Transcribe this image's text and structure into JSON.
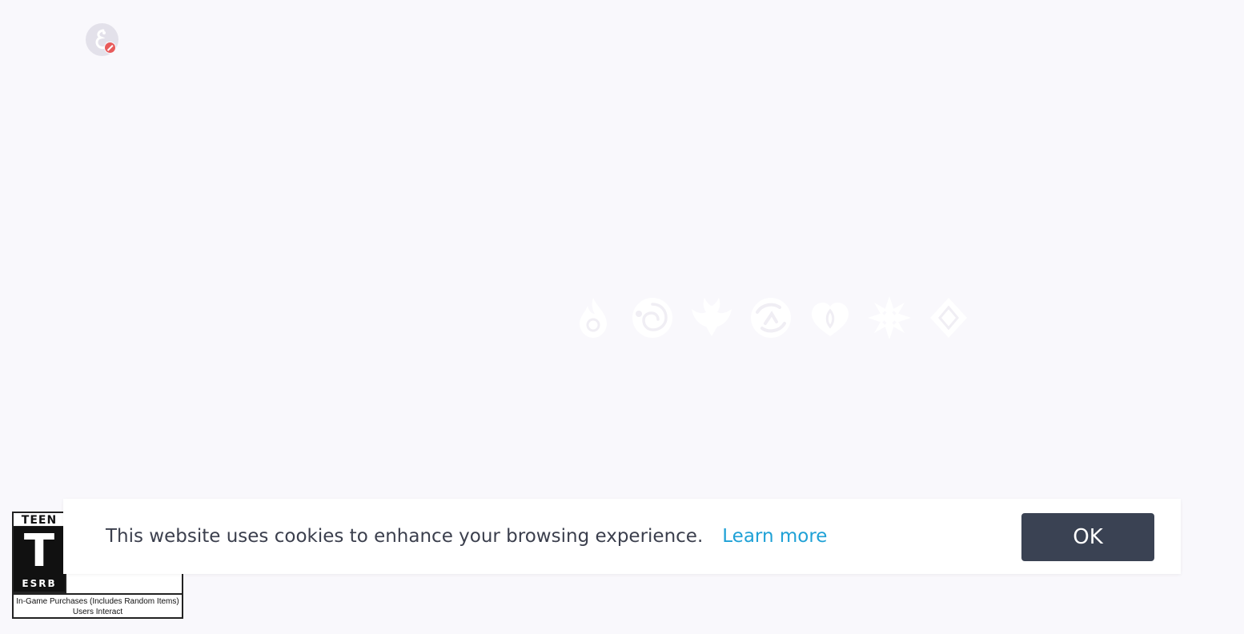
{
  "header": {
    "avatar_icon": "paimon-icon",
    "avatar_badge_icon": "muted-icon"
  },
  "loader": {
    "icons": [
      "pyro-icon",
      "hydro-icon",
      "anemo-icon",
      "electro-icon",
      "dendro-icon",
      "cryo-icon",
      "geo-icon"
    ],
    "icon_color": "#ffffff"
  },
  "esrb": {
    "rating_label": "TEEN",
    "rating_letter": "T",
    "organization": "ESRB",
    "descriptor_line1": "In-Game Purchases (Includes Random Items)",
    "descriptor_line2": "Users Interact"
  },
  "cookie_banner": {
    "message": "This website uses cookies to enhance your browsing experience.",
    "learn_more_label": "Learn more",
    "ok_label": "OK",
    "link_color": "#1fa1d6",
    "button_color": "#3a4253"
  }
}
